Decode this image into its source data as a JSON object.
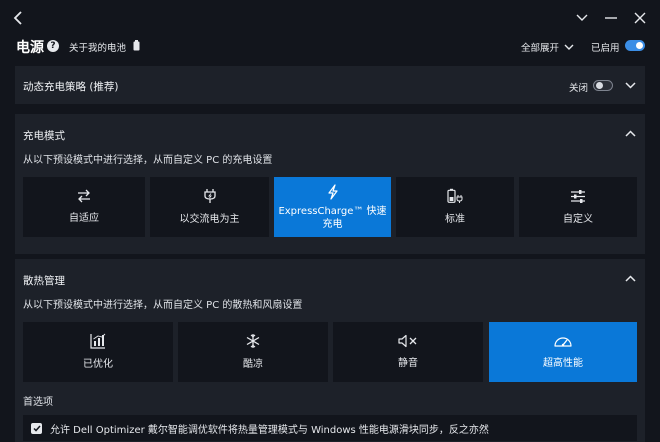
{
  "header": {
    "title": "电源",
    "about_battery": "关于我的电池",
    "expand_all": "全部展开",
    "enabled_label": "已启用",
    "enabled": true
  },
  "dynamic_charging": {
    "title": "动态充电策略 (推荐)",
    "toggle_label": "关闭",
    "enabled": false
  },
  "charge_mode": {
    "title": "充电模式",
    "subtitle": "从以下预设模式中进行选择，从而自定义 PC 的充电设置",
    "options": [
      {
        "label": "自适应",
        "icon": "swap-arrows-icon",
        "selected": false
      },
      {
        "label": "以交流电为主",
        "icon": "ac-plug-icon",
        "selected": false
      },
      {
        "label": "ExpressCharge™ 快速充电",
        "label_line1": "ExpressCharge™ 快速",
        "label_line2": "充电",
        "icon": "lightning-icon",
        "selected": true
      },
      {
        "label": "标准",
        "icon": "battery-plug-icon",
        "selected": false
      },
      {
        "label": "自定义",
        "icon": "sliders-icon",
        "selected": false
      }
    ]
  },
  "thermal": {
    "title": "散热管理",
    "subtitle": "从以下预设模式中进行选择，从而自定义 PC 的散热和风扇设置",
    "options": [
      {
        "label": "已优化",
        "icon": "chart-icon",
        "selected": false
      },
      {
        "label": "酷凉",
        "icon": "snowflake-icon",
        "selected": false
      },
      {
        "label": "静音",
        "icon": "mute-speaker-icon",
        "selected": false
      },
      {
        "label": "超高性能",
        "icon": "speedometer-icon",
        "selected": true
      }
    ],
    "preferences_label": "首选项",
    "sync_option": {
      "label": "允许 Dell Optimizer 戴尔智能调优软件将热量管理模式与 Windows 性能电源滑块同步，反之亦然",
      "checked": true
    }
  },
  "colors": {
    "background": "#12151c",
    "panel": "#1d2129",
    "accent": "#0a78d8"
  }
}
